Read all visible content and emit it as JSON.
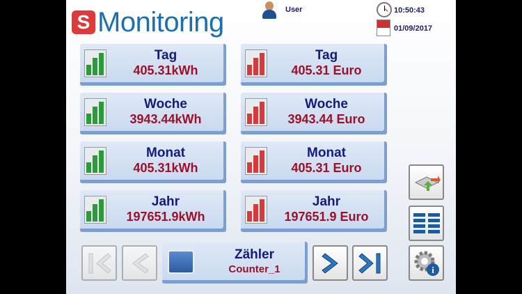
{
  "header": {
    "logo_letter": "S",
    "logo_text": "Monitoring",
    "user": "User",
    "time": "10:50:43",
    "date": "01/09/2017"
  },
  "tiles": [
    {
      "label": "Tag",
      "value": "405.31kWh",
      "kind": "energy"
    },
    {
      "label": "Tag",
      "value": "405.31 Euro",
      "kind": "cost"
    },
    {
      "label": "Woche",
      "value": "3943.44kWh",
      "kind": "energy"
    },
    {
      "label": "Woche",
      "value": "3943.44 Euro",
      "kind": "cost"
    },
    {
      "label": "Monat",
      "value": "405.31kWh",
      "kind": "energy"
    },
    {
      "label": "Monat",
      "value": "405.31 Euro",
      "kind": "cost"
    },
    {
      "label": "Jahr",
      "value": "197651.9kWh",
      "kind": "energy"
    },
    {
      "label": "Jahr",
      "value": "197651.9 Euro",
      "kind": "cost"
    }
  ],
  "counter": {
    "label": "Zähler",
    "value": "Counter_1"
  },
  "colors": {
    "energy": "#2a9a3a",
    "cost": "#d63a3a",
    "title": "#161a7a",
    "value": "#9a1128"
  }
}
